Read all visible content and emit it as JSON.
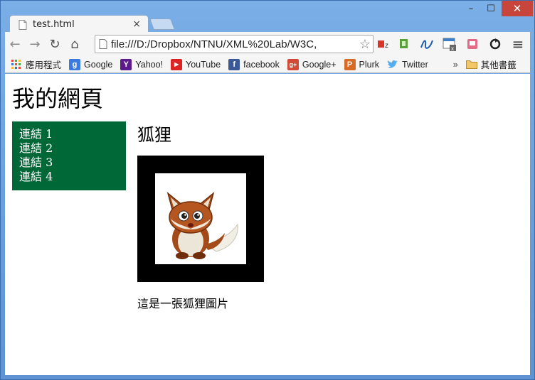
{
  "window": {
    "min": "–",
    "max": "☐",
    "close": "✕"
  },
  "tab": {
    "title": "test.html",
    "close": "×"
  },
  "toolbar": {
    "back": "←",
    "forward": "→",
    "reload": "↻",
    "home": "⌂",
    "address": "file:///D:/Dropbox/NTNU/XML%20Lab/W3C,",
    "star": "☆",
    "menu": "≡"
  },
  "bookmarks": [
    {
      "label": "應用程式",
      "icon": "apps-icon"
    },
    {
      "label": "Google",
      "icon": "google-icon"
    },
    {
      "label": "Yahoo!",
      "icon": "yahoo-icon"
    },
    {
      "label": "YouTube",
      "icon": "youtube-icon"
    },
    {
      "label": "facebook",
      "icon": "facebook-icon"
    },
    {
      "label": "Google+",
      "icon": "google-plus-icon"
    },
    {
      "label": "Plurk",
      "icon": "plurk-icon"
    },
    {
      "label": "Twitter",
      "icon": "twitter-icon"
    }
  ],
  "bookmarks_overflow": "»",
  "other_bookmarks": "其他書籤",
  "page": {
    "title": "我的網頁",
    "nav": [
      "連結 1",
      "連結 2",
      "連結 3",
      "連結 4"
    ],
    "heading": "狐狸",
    "caption": "這是一張狐狸圖片"
  },
  "colors": {
    "nav_bg": "#006837",
    "frame_bg": "#000000",
    "window_frame": "#6fa2d9",
    "close_button": "#c7453a"
  }
}
